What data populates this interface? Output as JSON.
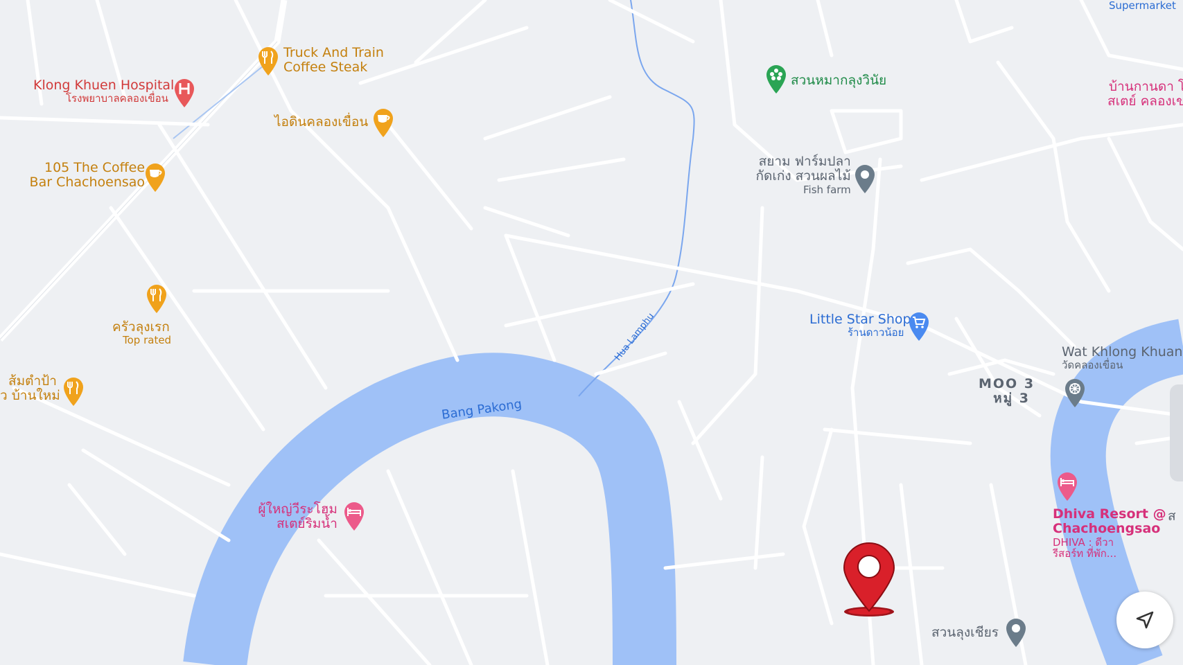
{
  "colors": {
    "land": "#eef0f3",
    "road": "#ffffff",
    "water": "#9fc1f7",
    "food": "#f0a21c",
    "hospital": "#e8585a",
    "lodging": "#ec5a8a",
    "shop": "#4a8af0",
    "park": "#2aa454",
    "pin": "#d9202a"
  },
  "labels": {
    "supermarket": "Supermarket",
    "truck_train_1": "Truck And Train",
    "truck_train_2": "Coffee Steak",
    "hospital_en": "Klong Khuen Hospital",
    "hospital_th": "โรงพยาบาลคลองเขื่อน",
    "aidin": "ไอดินคลองเขื่อน",
    "coffee105_1": "105 The Coffee",
    "coffee105_2": "Bar Chachoensao",
    "khrua_lung": "ครัวลุงเรก",
    "top_rated": "Top rated",
    "somtam_1": "ส้มตำป้า",
    "somtam_2": "ว บ้านใหม่",
    "suan_mak": "สวนหมากลุงวินัย",
    "fishfarm_1": "สยาม ฟาร์มปลา",
    "fishfarm_2": "กัดเก่ง สวนผลไม้",
    "fishfarm_sub": "Fish farm",
    "baan_1": "บ้านกานดา โ",
    "baan_2": "สเตย์ คลองเข",
    "little_star": "Little Star Shop",
    "little_star_th": "ร้านดาวน้อย",
    "wat_en": "Wat Khlong Khuan",
    "wat_th": "วัดคลองเขื่อน",
    "moo_en": "MOO 3",
    "moo_th": "หมู่ 3",
    "bang_pakong": "Bang Pakong",
    "hua_lamphu": "Hua Lamphu",
    "pu_yai_1": "ผู้ใหญ่วีระโฮม",
    "pu_yai_2": "สเตย์ริมน้ำ",
    "dhiva_1": "Dhiva Resort @",
    "dhiva_2": "Chachoengsao",
    "dhiva_th1": "DHIVA : ดีวา",
    "dhiva_th2": "รีสอร์ท ที่พัก...",
    "edge_char": "ส",
    "suan_lung": "สวนลุงเชียร"
  },
  "icons": {
    "food": "fork-knife-icon",
    "coffee": "coffee-cup-icon",
    "hospital": "hospital-h-icon",
    "park": "flower-icon",
    "place": "location-dot-icon",
    "shop": "shopping-cart-icon",
    "temple": "dharma-wheel-icon",
    "hotel": "bed-icon",
    "pin": "red-location-pin-icon",
    "nav": "navigation-arrow-icon"
  }
}
